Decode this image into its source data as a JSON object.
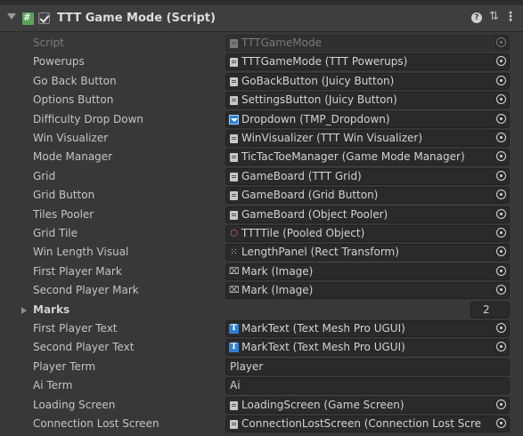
{
  "component": {
    "title": "TTT Game Mode (Script)",
    "enabled": true,
    "help_icon": "help-icon",
    "preset_icon": "preset-icon",
    "menu_icon": "kebab-menu-icon"
  },
  "rows": [
    {
      "label": "Script",
      "value": "TTTGameMode",
      "icon": "script-file-icon",
      "disabled": true
    },
    {
      "label": "Powerups",
      "value": "TTTGameMode (TTT Powerups)",
      "icon": "object-icon"
    },
    {
      "label": "Go Back Button",
      "value": "GoBackButton (Juicy Button)",
      "icon": "object-icon"
    },
    {
      "label": "Options Button",
      "value": "SettingsButton (Juicy Button)",
      "icon": "object-icon"
    },
    {
      "label": "Difficulty Drop Down",
      "value": "Dropdown (TMP_Dropdown)",
      "icon": "dropdown-icon"
    },
    {
      "label": "Win Visualizer",
      "value": "WinVisualizer (TTT Win Visualizer)",
      "icon": "object-icon"
    },
    {
      "label": "Mode Manager",
      "value": "TicTacToeManager (Game Mode Manager)",
      "icon": "object-icon"
    },
    {
      "label": "Grid",
      "value": "GameBoard (TTT Grid)",
      "icon": "object-icon"
    },
    {
      "label": "Grid Button",
      "value": "GameBoard (Grid Button)",
      "icon": "object-icon"
    },
    {
      "label": "Tiles Pooler",
      "value": "GameBoard (Object Pooler)",
      "icon": "object-icon"
    },
    {
      "label": "Grid Tile",
      "value": "TTTTile (Pooled Object)",
      "icon": "prefab-icon"
    },
    {
      "label": "Win Length Visual",
      "value": "LengthPanel (Rect Transform)",
      "icon": "rect-transform-icon"
    },
    {
      "label": "First Player Mark",
      "value": "Mark (Image)",
      "icon": "image-icon"
    },
    {
      "label": "Second Player Mark",
      "value": "Mark (Image)",
      "icon": "image-icon"
    },
    {
      "label": "Marks",
      "value": "2",
      "foldout": true
    },
    {
      "label": "First Player Text",
      "value": "MarkText (Text Mesh Pro UGUI)",
      "icon": "text-mesh-pro-icon"
    },
    {
      "label": "Second Player Text",
      "value": "MarkText (Text Mesh Pro UGUI)",
      "icon": "text-mesh-pro-icon"
    },
    {
      "label": "Player Term",
      "value": "Player",
      "text_field": true
    },
    {
      "label": "Ai Term",
      "value": "Ai",
      "text_field": true
    },
    {
      "label": "Loading Screen",
      "value": "LoadingScreen (Game Screen)",
      "icon": "object-icon"
    },
    {
      "label": "Connection Lost Screen",
      "value": "ConnectionLostScreen (Connection Lost Scre",
      "icon": "object-icon"
    }
  ]
}
